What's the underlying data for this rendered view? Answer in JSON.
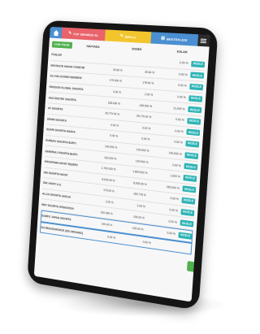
{
  "colors": {
    "home": "#4a8fd1",
    "tab1": "#e9636a",
    "tab2": "#f3c52d",
    "tab3": "#4a8fd1",
    "action": "#2bb3b5",
    "green": "#4fb04c"
  },
  "tabs": [
    {
      "label": "TOP SEKMESI AL",
      "icon": "pencil-icon"
    },
    {
      "label": "BEKLE",
      "icon": "pencil-icon"
    },
    {
      "label": "BESTEKLESI",
      "icon": "clipboard-icon"
    }
  ],
  "toolbar": {
    "coins_label": "COIN TFEAE"
  },
  "columns": [
    "HAFTADA",
    "SOSES",
    "KALAN"
  ],
  "list_title": "FONLAR",
  "rows": [
    {
      "name": "FONLAR",
      "v1": "",
      "v2": "",
      "v3": "0.00 %",
      "btn": "INCELE"
    },
    {
      "name": "MOVIKSTE HAVAN YONETIM",
      "v1": "30.90 %",
      "v2": "30.64 %",
      "v3": "0.00 %",
      "btn": "INCELE"
    },
    {
      "name": "ALI HALCIOGEN SERINESI",
      "v1": "179.000 %",
      "v2": "178.90 %",
      "v3": "0.00 %",
      "btn": "INCELE"
    },
    {
      "name": "NSKISON GLOBAL SIGORTA",
      "v1": "2.00 %",
      "v2": "2.00 %",
      "v3": "0.00 %",
      "btn": "INCELE"
    },
    {
      "name": "AKA DESTEK SIGORTA",
      "v1": "165.000 %",
      "v2": "165.000 %",
      "v3": "21,000 %",
      "btn": "INCELE"
    },
    {
      "name": "AF SIGORTA",
      "v1": "26,770.00 %",
      "v2": "26,770.00 %",
      "v3": "0.00 %",
      "btn": "INCELE"
    },
    {
      "name": "DENIR SIGORTA",
      "v1": "0.00 %",
      "v2": "0.00 %",
      "v3": "0.00 %",
      "btn": "INCELE"
    },
    {
      "name": "NUKRI SIGORTA HASKA",
      "v1": "0.00 %",
      "v2": "0.00 %",
      "v3": "0.00 %",
      "btn": "INCELE"
    },
    {
      "name": "EUREKO SIGORTA BURTI",
      "v1": "100.000 %",
      "v2": "100.000 %",
      "v3": "100,000 %",
      "btn": "INCELE"
    },
    {
      "name": "GENERALI SIGORTA BURTI",
      "v1": "100.000 %",
      "v2": "100.000 %",
      "v3": "0.00 %",
      "btn": "INCELE"
    },
    {
      "name": "GROUPAMA HAYAT REZERV",
      "v1": "1,700.000 %",
      "v2": "1,800.000 %",
      "v3": "1,000 %",
      "btn": "INCELE"
    },
    {
      "name": "HDI SIGORTA HAYAT",
      "v1": "8,000.00 %",
      "v2": "8,000.00 %",
      "v3": "260,000 %",
      "btn": "INCELE"
    },
    {
      "name": "ISIK HAYAT A.S.",
      "v1": "179.00 %",
      "v2": "182,778 %",
      "v3": "0.00 %",
      "btn": "INCELE"
    },
    {
      "name": "ALLIA SIGORTA SAGLIK",
      "v1": "2.00 %",
      "v2": "2.00 %",
      "v3": "0.00 %",
      "btn": "INCELE"
    },
    {
      "name": "MNY SIGORTA OPERATION",
      "v1": "100.000 %",
      "v2": "100.00 %",
      "v3": "0.00 %",
      "btn": "INCELE"
    },
    {
      "name": "SOMPO JAPAN SIGORTA",
      "v1": "100.00 %",
      "v2": "100.00 %",
      "v3": "0.00 %",
      "btn": "INCELE"
    },
    {
      "name": "ZUI REASSURANCE (DIS ORGANIZ)",
      "v1": "0.00 %",
      "v2": "0.00 %",
      "v3": "",
      "btn": ""
    }
  ]
}
